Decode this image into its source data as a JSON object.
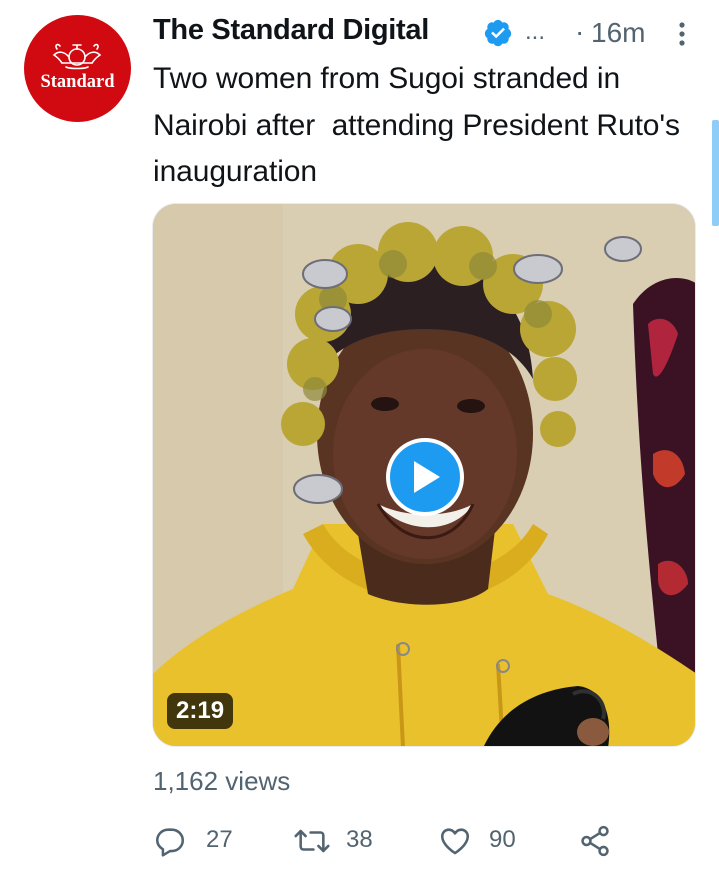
{
  "tweet": {
    "avatar_text": "Standard",
    "display_name": "The Standard Digital",
    "name_overflow": "...",
    "separator": "·",
    "time": "16m",
    "text": "Two women from Sugoi stranded in Nairobi after  attending President Ruto's inauguration",
    "video": {
      "duration": "2:19"
    },
    "views": "1,162 views",
    "actions": {
      "reply_count": "27",
      "retweet_count": "38",
      "like_count": "90"
    }
  },
  "colors": {
    "accent": "#1d9bf0",
    "brand_red": "#d10a11",
    "secondary_text": "#536471",
    "primary_text": "#0f1419"
  },
  "icons": {
    "verified": "verified-badge-icon",
    "more": "more-vertical-icon",
    "play": "play-icon",
    "reply": "reply-icon",
    "retweet": "retweet-icon",
    "like": "heart-icon",
    "share": "share-icon"
  }
}
